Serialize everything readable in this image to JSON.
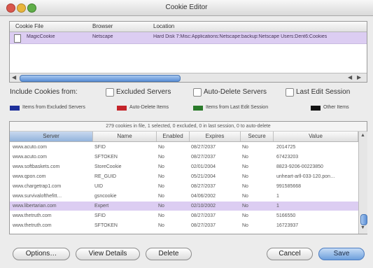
{
  "window": {
    "title": "Cookie Editor"
  },
  "files": {
    "columns": [
      "Cookie File",
      "Browser",
      "Location"
    ],
    "rows": [
      {
        "file": "MagicCookie",
        "browser": "Netscape",
        "location": "Hard Disk 7:Misc:Applications:Netscape:backup:Netscape Users:Dent6:Cookies"
      }
    ]
  },
  "include": {
    "label": "Include Cookies from:",
    "options": [
      {
        "label": "Excluded Servers",
        "checked": false
      },
      {
        "label": "Auto-Delete Servers",
        "checked": false
      },
      {
        "label": "Last Edit Session",
        "checked": false
      }
    ]
  },
  "legend": [
    {
      "label": "Items from Excluded Servers",
      "color": "#1d2f9a"
    },
    {
      "label": "Auto-Delete Items",
      "color": "#c4242a"
    },
    {
      "label": "Items from Last Edit Session",
      "color": "#2a7a2a"
    },
    {
      "label": "Other Items",
      "color": "#111111"
    }
  ],
  "cookies": {
    "summary": "279 cookies in file, 1 selected, 0 excluded, 0 in last session, 0 to auto-delete",
    "columns": [
      "Server",
      "Name",
      "Enabled",
      "Expires",
      "Secure",
      "Value"
    ],
    "rows": [
      [
        "www.acuto.com",
        "SFID",
        "No",
        "08/27/2037",
        "No",
        "2014725"
      ],
      [
        "www.acuto.com",
        "SFTOKEN",
        "No",
        "08/27/2037",
        "No",
        "67423203"
      ],
      [
        "www.softbaskets.com",
        "StoreCookie",
        "No",
        "02/01/2004",
        "No",
        "8823-9206-00223850"
      ],
      [
        "www.qpon.com",
        "RE_GUID",
        "No",
        "05/21/2004",
        "No",
        "unheart-arll-033-120.pon…"
      ],
      [
        "www.chargetrap1.com",
        "UID",
        "No",
        "08/27/2037",
        "No",
        "991585668"
      ],
      [
        "www.survivalofthefitt…",
        "gsncookie",
        "No",
        "04/06/2002",
        "No",
        "1"
      ],
      [
        "www.libertarian.com",
        "Expert",
        "No",
        "02/10/2002",
        "No",
        "1"
      ],
      [
        "www.thetruth.com",
        "SFID",
        "No",
        "08/27/2037",
        "No",
        "5166550"
      ],
      [
        "www.thetruth.com",
        "SFTOKEN",
        "No",
        "08/27/2037",
        "No",
        "16723937"
      ]
    ],
    "selected_index": 6
  },
  "buttons": {
    "options": "Options…",
    "view_details": "View Details",
    "delete": "Delete",
    "cancel": "Cancel",
    "save": "Save"
  }
}
